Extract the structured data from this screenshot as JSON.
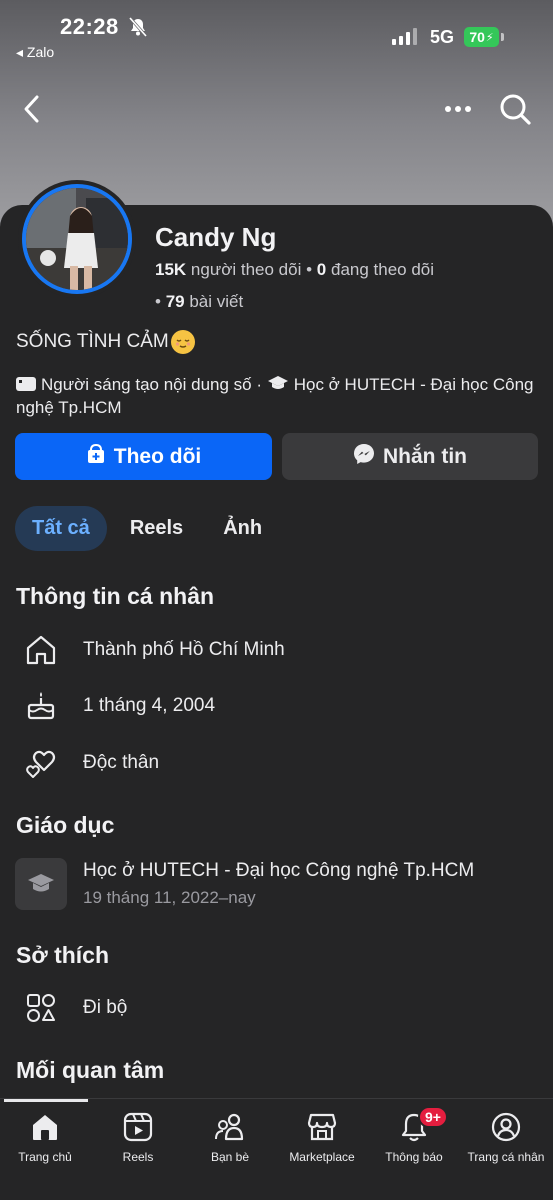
{
  "status_bar": {
    "time": "22:28",
    "back_app": "◂ Zalo",
    "network": "5G",
    "battery": "70"
  },
  "profile": {
    "name": "Candy Ng",
    "followers_count": "15K",
    "followers_label": "người theo dõi",
    "following_count": "0",
    "following_label": "đang theo dõi",
    "posts_count": "79",
    "posts_label": "bài viết",
    "bio": "SỐNG TÌNH CẢM",
    "meta_creator": "Người sáng tạo nội dung số",
    "meta_school": "Học ở HUTECH - Đại học Công nghệ Tp.HCM"
  },
  "buttons": {
    "follow": "Theo dõi",
    "message": "Nhắn tin"
  },
  "tabs": [
    {
      "label": "Tất cả",
      "active": true
    },
    {
      "label": "Reels",
      "active": false
    },
    {
      "label": "Ảnh",
      "active": false
    }
  ],
  "personal_info": {
    "title": "Thông tin cá nhân",
    "city": "Thành phố Hồ Chí Minh",
    "birthday": "1 tháng 4, 2004",
    "relationship": "Độc thân"
  },
  "education": {
    "title": "Giáo dục",
    "school": "Học ở HUTECH - Đại học Công nghệ Tp.HCM",
    "period": "19 tháng 11, 2022–nay"
  },
  "hobbies": {
    "title": "Sở thích",
    "item": "Đi bộ"
  },
  "interests": {
    "title": "Mối quan tâm"
  },
  "tabbar": {
    "home": "Trang chủ",
    "reels": "Reels",
    "friends": "Bạn bè",
    "marketplace": "Marketplace",
    "notifications": "Thông báo",
    "notifications_badge": "9+",
    "profile": "Trang cá nhân"
  },
  "colors": {
    "accent": "#0a66f7",
    "badge": "#e41e3f",
    "battery": "#34c759"
  }
}
